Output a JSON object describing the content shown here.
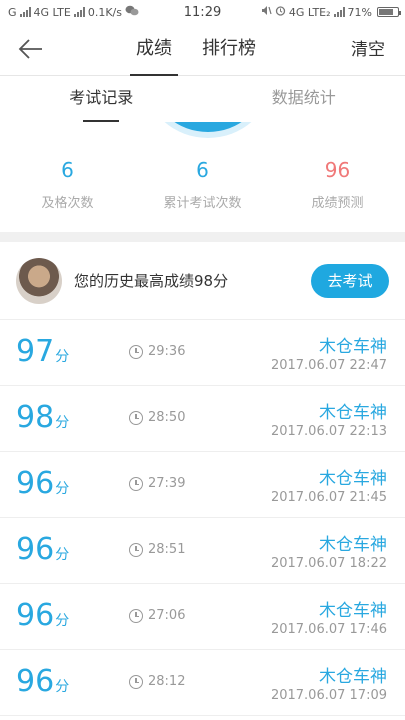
{
  "status_bar": {
    "carrier_left": "G",
    "network1": "4G LTE",
    "speed": "0.1K/s",
    "time": "11:29",
    "network2": "4G LTE₂",
    "battery": "71%"
  },
  "nav": {
    "tabs": [
      {
        "label": "成绩",
        "active": true
      },
      {
        "label": "排行榜",
        "active": false
      }
    ],
    "clear_label": "清空"
  },
  "subtabs": [
    {
      "label": "考试记录",
      "active": true
    },
    {
      "label": "数据统计",
      "active": false
    }
  ],
  "stats": [
    {
      "value": "6",
      "label": "及格次数"
    },
    {
      "value": "6",
      "label": "累计考试次数"
    },
    {
      "value": "96",
      "label": "成绩预测"
    }
  ],
  "best": {
    "text": "您的历史最高成绩98分",
    "button_label": "去考试"
  },
  "records": [
    {
      "score": "97",
      "unit": "分",
      "duration": "29:36",
      "name": "木仓车神",
      "datetime": "2017.06.07  22:47"
    },
    {
      "score": "98",
      "unit": "分",
      "duration": "28:50",
      "name": "木仓车神",
      "datetime": "2017.06.07  22:13"
    },
    {
      "score": "96",
      "unit": "分",
      "duration": "27:39",
      "name": "木仓车神",
      "datetime": "2017.06.07  21:45"
    },
    {
      "score": "96",
      "unit": "分",
      "duration": "28:51",
      "name": "木仓车神",
      "datetime": "2017.06.07  18:22"
    },
    {
      "score": "96",
      "unit": "分",
      "duration": "27:06",
      "name": "木仓车神",
      "datetime": "2017.06.07  17:46"
    },
    {
      "score": "96",
      "unit": "分",
      "duration": "28:12",
      "name": "木仓车神",
      "datetime": "2017.06.07  17:09"
    }
  ],
  "colors": {
    "accent": "#29a8e0",
    "predict": "#f07878",
    "button": "#1fa8e0"
  }
}
